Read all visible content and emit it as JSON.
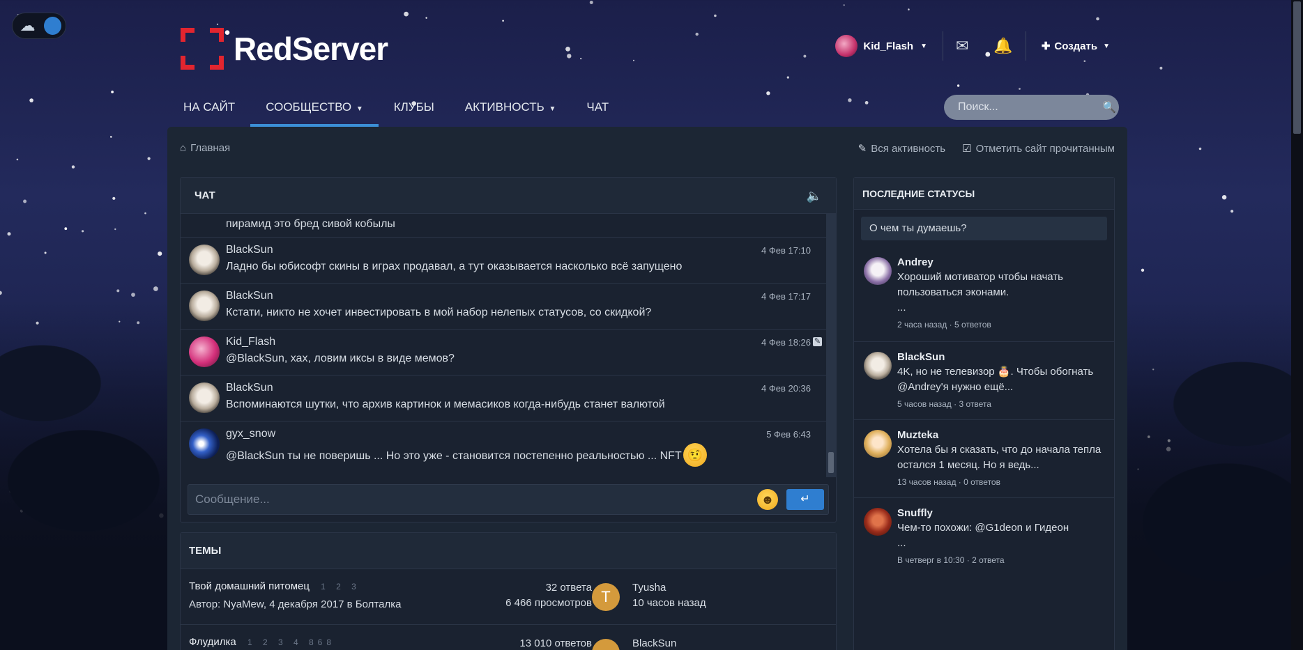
{
  "brand": {
    "name": "RedServer"
  },
  "user_bar": {
    "username": "Kid_Flash",
    "create_label": "Создать"
  },
  "nav": {
    "items": [
      {
        "label": "НА САЙТ",
        "dropdown": false
      },
      {
        "label": "СООБЩЕСТВО",
        "dropdown": true,
        "active": true
      },
      {
        "label": "КЛУБЫ",
        "dropdown": false
      },
      {
        "label": "АКТИВНОСТЬ",
        "dropdown": true
      },
      {
        "label": "ЧАТ",
        "dropdown": false
      }
    ]
  },
  "search": {
    "placeholder": "Поиск..."
  },
  "breadcrumb": {
    "home": "Главная"
  },
  "top_actions": {
    "all_activity": "Вся активность",
    "mark_read": "Отметить сайт прочитанным"
  },
  "chat": {
    "title": "ЧАТ",
    "partial_message": "пирамид это бред сивой кобылы",
    "messages": [
      {
        "name": "BlackSun",
        "time": "4 Фев 17:10",
        "text": "Ладно бы юбисофт скины в играх продавал, а тут оказывается насколько всё запущено"
      },
      {
        "name": "BlackSun",
        "time": "4 Фев 17:17",
        "text": "Кстати, никто не хочет инвестировать в мой набор нелепых статусов, со скидкой?"
      },
      {
        "name": "Kid_Flash",
        "time": "4 Фев 18:26",
        "text": "@BlackSun, хах, ловим иксы в виде мемов?"
      },
      {
        "name": "BlackSun",
        "time": "4 Фев 20:36",
        "text": "Вспоминаются шутки, что архив картинок и мемасиков когда-нибудь станет валютой"
      },
      {
        "name": "gyx_snow",
        "time": "5 Фев 6:43",
        "text": "@BlackSun ты не поверишь ... Но это уже - становится постепенно реальностью ... NFT"
      }
    ],
    "composer_placeholder": "Сообщение..."
  },
  "topics": {
    "title": "ТЕМЫ",
    "rows": [
      {
        "title": "Твой домашний питомец",
        "pages": "1 2 3",
        "author_prefix": "Автор: ",
        "author": "NyaMew",
        "meta_rest": ", 4 декабря 2017 в Болталка",
        "replies": "32 ответа",
        "views": "6 466 просмотров",
        "last_avatar_letter": "T",
        "last_user": "Tyusha",
        "last_time": "10 часов назад"
      },
      {
        "title": "Флудилка",
        "pages": "1 2 3 4 868",
        "replies": "13 010 ответов",
        "last_user": "BlackSun"
      }
    ]
  },
  "statuses": {
    "title": "ПОСЛЕДНИЕ СТАТУСЫ",
    "placeholder": "О чем ты думаешь?",
    "items": [
      {
        "name": "Andrey",
        "text": "Хороший мотиватор чтобы начать пользоваться эконами.",
        "ellipsis": "...",
        "meta": "2 часа назад · 5 ответов"
      },
      {
        "name": "BlackSun",
        "text": "4K, но не телевизор 🎂. Чтобы обогнать @Andrey'я нужно ещё...",
        "meta": "5 часов назад · 3 ответа"
      },
      {
        "name": "Muzteka",
        "text": "Хотела бы я сказать, что до начала тепла остался 1 месяц. Но я ведь...",
        "meta": "13 часов назад · 0 ответов"
      },
      {
        "name": "Snuffly",
        "text": "Чем-то похожи: @G1deon и Гидеон",
        "ellipsis": "...",
        "meta": "В четверг в 10:30 · 2 ответа"
      }
    ]
  }
}
